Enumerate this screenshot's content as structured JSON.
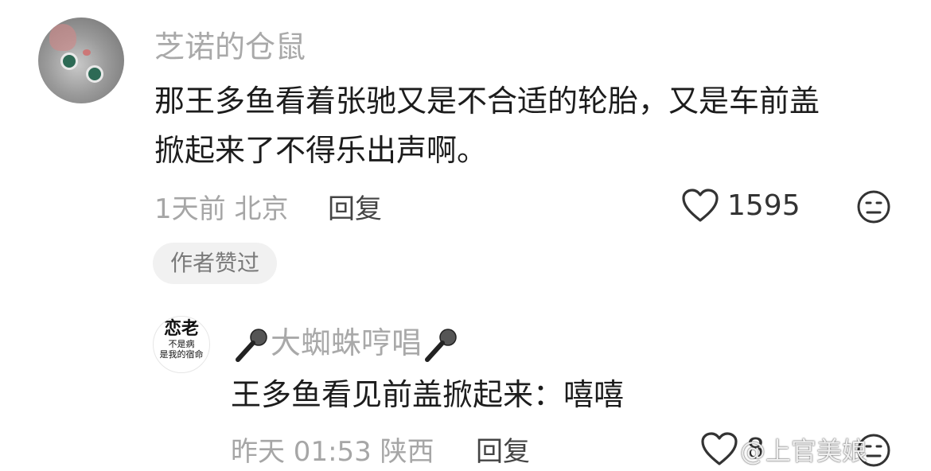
{
  "comment": {
    "username": "芝诺的仓鼠",
    "text_line1": "那王多鱼看着张驰又是不合适的轮胎，又是车前盖",
    "text_line2": "掀起来了不得乐出声啊。",
    "time_location": "1天前 北京",
    "reply_label": "回复",
    "like_count": "1595",
    "author_badge": "作者赞过"
  },
  "reply": {
    "username": "大蜘蛛哼唱",
    "avatar_text_big": "恋老",
    "avatar_text_small1": "不是病",
    "avatar_text_small2": "是我的宿命",
    "text": "王多鱼看见前盖掀起来：嘻嘻",
    "time_location": "昨天 01:53 陕西",
    "reply_label": "回复",
    "like_count": "8"
  },
  "watermark": "@上官美娘"
}
